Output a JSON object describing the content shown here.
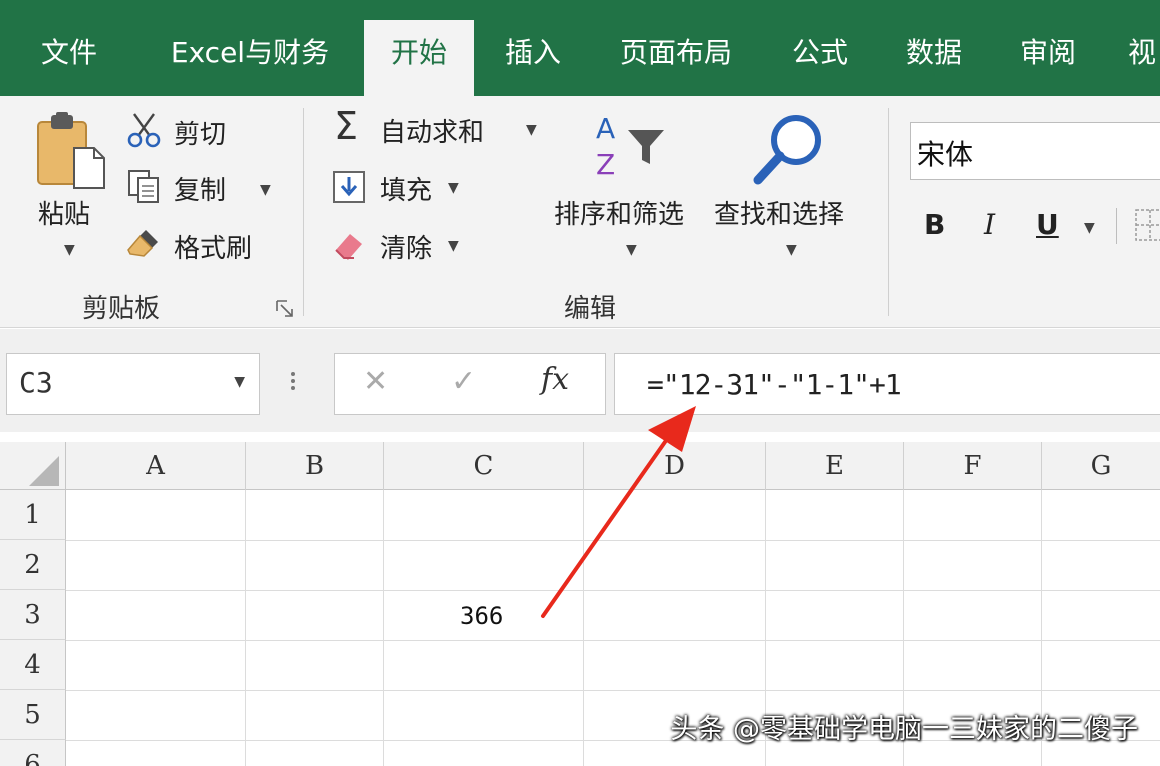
{
  "tabs": [
    {
      "label": "文件"
    },
    {
      "label": "Excel与财务"
    },
    {
      "label": "开始",
      "active": true
    },
    {
      "label": "插入"
    },
    {
      "label": "页面布局"
    },
    {
      "label": "公式"
    },
    {
      "label": "数据"
    },
    {
      "label": "审阅"
    },
    {
      "label": "视"
    }
  ],
  "ribbon": {
    "clipboard": {
      "paste": "粘贴",
      "cut": "剪切",
      "copy": "复制",
      "format_painter": "格式刷",
      "group_label": "剪贴板"
    },
    "editing": {
      "autosum": "自动求和",
      "fill": "填充",
      "clear": "清除",
      "sort_filter": "排序和筛选",
      "find_select": "查找和选择",
      "group_label": "编辑"
    },
    "font": {
      "font_name": "宋体",
      "bold": "B",
      "italic": "I",
      "underline": "U"
    }
  },
  "formula_bar": {
    "name_box": "C3",
    "fx_label": "fx",
    "formula": "=\"12-31\"-\"1-1\"+1"
  },
  "sheet": {
    "columns": [
      "A",
      "B",
      "C",
      "D",
      "E",
      "F",
      "G"
    ],
    "rows": [
      "1",
      "2",
      "3",
      "4",
      "5",
      "6"
    ],
    "cells": {
      "C3": "366"
    }
  },
  "watermark": "头条 @零基础学电脑一三妹家的二傻子",
  "colors": {
    "brand": "#217346",
    "annotation_arrow": "#e8291c"
  }
}
